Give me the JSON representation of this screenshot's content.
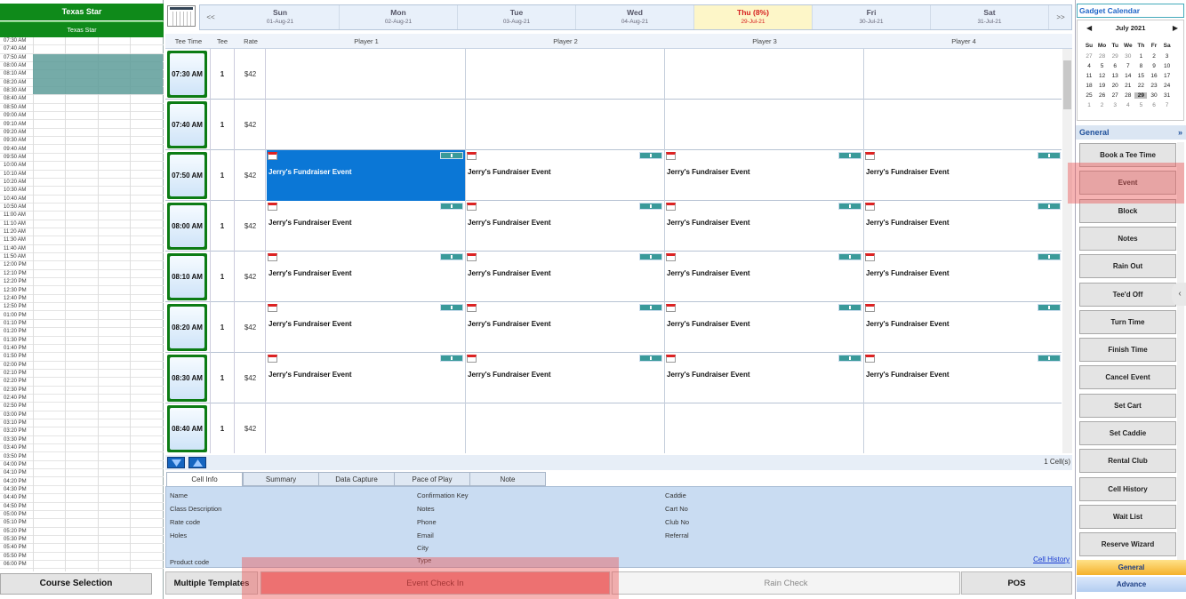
{
  "course": {
    "title": "Texas Star",
    "subtitle": "Texas Star",
    "selection_button": "Course Selection"
  },
  "mini_times": [
    "07:30 AM",
    "07:40 AM",
    "07:50 AM",
    "08:00 AM",
    "08:10 AM",
    "08:20 AM",
    "08:30 AM",
    "08:40 AM",
    "08:50 AM",
    "09:00 AM",
    "09:10 AM",
    "09:20 AM",
    "09:30 AM",
    "09:40 AM",
    "09:50 AM",
    "10:00 AM",
    "10:10 AM",
    "10:20 AM",
    "10:30 AM",
    "10:40 AM",
    "10:50 AM",
    "11:00 AM",
    "11:10 AM",
    "11:20 AM",
    "11:30 AM",
    "11:40 AM",
    "11:50 AM",
    "12:00 PM",
    "12:10 PM",
    "12:20 PM",
    "12:30 PM",
    "12:40 PM",
    "12:50 PM",
    "01:00 PM",
    "01:10 PM",
    "01:20 PM",
    "01:30 PM",
    "01:40 PM",
    "01:50 PM",
    "02:00 PM",
    "02:10 PM",
    "02:20 PM",
    "02:30 PM",
    "02:40 PM",
    "02:50 PM",
    "03:00 PM",
    "03:10 PM",
    "03:20 PM",
    "03:30 PM",
    "03:40 PM",
    "03:50 PM",
    "04:00 PM",
    "04:10 PM",
    "04:20 PM",
    "04:30 PM",
    "04:40 PM",
    "04:50 PM",
    "05:00 PM",
    "05:10 PM",
    "05:20 PM",
    "05:30 PM",
    "05:40 PM",
    "05:50 PM",
    "06:00 PM"
  ],
  "nav": {
    "prev": "<<",
    "next": ">>",
    "days": [
      {
        "name": "Sun",
        "date": "01-Aug-21"
      },
      {
        "name": "Mon",
        "date": "02-Aug-21"
      },
      {
        "name": "Tue",
        "date": "03-Aug-21"
      },
      {
        "name": "Wed",
        "date": "04-Aug-21"
      },
      {
        "name": "Thu (8%)",
        "date": "29-Jul-21",
        "today": true
      },
      {
        "name": "Fri",
        "date": "30-Jul-21"
      },
      {
        "name": "Sat",
        "date": "31-Jul-21"
      }
    ]
  },
  "columns": {
    "tee_time": "Tee Time",
    "tee": "Tee",
    "rate": "Rate",
    "players": [
      "Player 1",
      "Player 2",
      "Player 3",
      "Player 4"
    ]
  },
  "rows": [
    {
      "time": "07:30 AM",
      "tee": "1",
      "rate": "$42",
      "event": ""
    },
    {
      "time": "07:40 AM",
      "tee": "1",
      "rate": "$42",
      "event": ""
    },
    {
      "time": "07:50 AM",
      "tee": "1",
      "rate": "$42",
      "event": "Jerry's Fundraiser Event"
    },
    {
      "time": "08:00 AM",
      "tee": "1",
      "rate": "$42",
      "event": "Jerry's Fundraiser Event"
    },
    {
      "time": "08:10 AM",
      "tee": "1",
      "rate": "$42",
      "event": "Jerry's Fundraiser Event"
    },
    {
      "time": "08:20 AM",
      "tee": "1",
      "rate": "$42",
      "event": "Jerry's Fundraiser Event"
    },
    {
      "time": "08:30 AM",
      "tee": "1",
      "rate": "$42",
      "event": "Jerry's Fundraiser Event"
    },
    {
      "time": "08:40 AM",
      "tee": "1",
      "rate": "$42",
      "event": ""
    }
  ],
  "cell_count": "1 Cell(s)",
  "tabs": [
    "Cell Info",
    "Summary",
    "Data Capture",
    "Pace of Play",
    "Note"
  ],
  "info_fields": {
    "col1": [
      "Name",
      "Class Description",
      "Rate code",
      "Holes",
      "Product code"
    ],
    "col2": [
      "Confirmation Key",
      "Notes",
      "Phone",
      "Email",
      "City",
      "Type"
    ],
    "col3": [
      "Caddie",
      "Cart No",
      "Club No",
      "Referral"
    ],
    "cell_history": "Cell History"
  },
  "bottom": {
    "multiple_templates": "Multiple Templates",
    "event_check_in": "Event Check In",
    "rain_check": "Rain Check",
    "pos": "POS"
  },
  "gadget": {
    "title": "Gadget Calendar",
    "month": "July 2021",
    "prev": "◀",
    "next": "▶",
    "dow": [
      "Su",
      "Mo",
      "Tu",
      "We",
      "Th",
      "Fr",
      "Sa"
    ],
    "weeks": [
      [
        "27",
        "28",
        "29",
        "30",
        "1",
        "2",
        "3"
      ],
      [
        "4",
        "5",
        "6",
        "7",
        "8",
        "9",
        "10"
      ],
      [
        "11",
        "12",
        "13",
        "14",
        "15",
        "16",
        "17"
      ],
      [
        "18",
        "19",
        "20",
        "21",
        "22",
        "23",
        "24"
      ],
      [
        "25",
        "26",
        "27",
        "28",
        "29",
        "30",
        "31"
      ],
      [
        "1",
        "2",
        "3",
        "4",
        "5",
        "6",
        "7"
      ]
    ]
  },
  "general": {
    "title": "General",
    "expand": "»",
    "buttons": [
      "Book a Tee Time",
      "Event",
      "Block",
      "Notes",
      "Rain Out",
      "Tee'd Off",
      "Turn Time",
      "Finish Time",
      "Cancel Event",
      "Set Cart",
      "Set Caddie",
      "Rental Club",
      "Cell History",
      "Wait List",
      "Reserve Wizard"
    ]
  },
  "bottom_tabs": {
    "general": "General",
    "advance": "Advance"
  },
  "colors": {
    "green": "#0f8a1a",
    "selected": "#0b77d6",
    "highlight": "#ec5656"
  }
}
